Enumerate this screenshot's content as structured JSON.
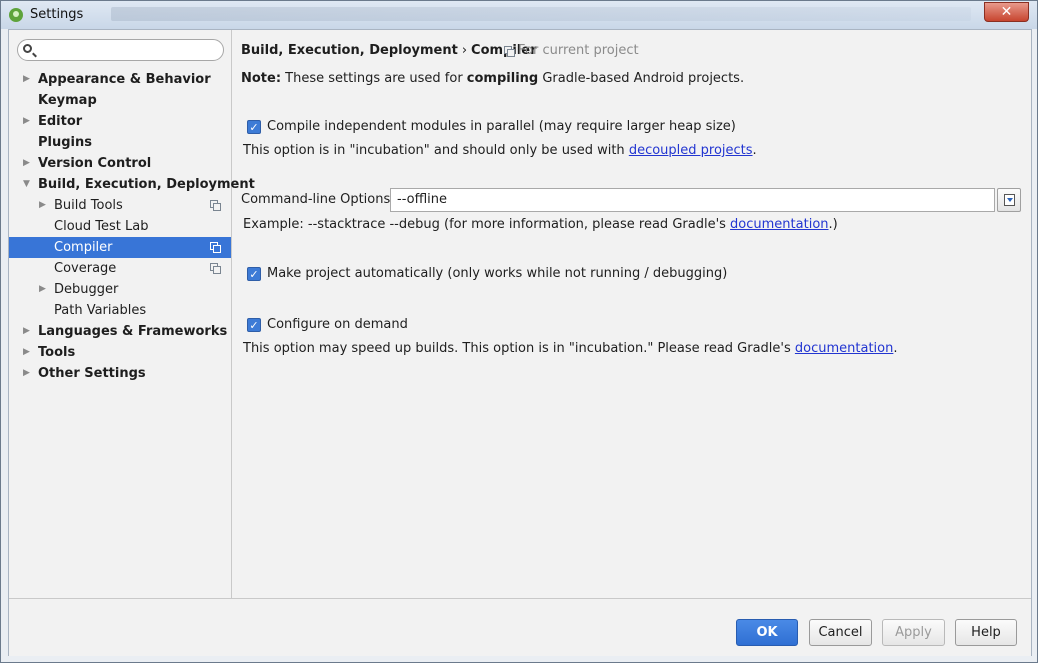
{
  "window": {
    "title": "Settings",
    "close_label": "✕"
  },
  "sidebar": {
    "search": {
      "value": "",
      "placeholder": ""
    },
    "items": [
      {
        "label": "Appearance & Behavior",
        "expandable": true,
        "bold": true
      },
      {
        "label": "Keymap",
        "expandable": false,
        "bold": true
      },
      {
        "label": "Editor",
        "expandable": true,
        "bold": true
      },
      {
        "label": "Plugins",
        "expandable": false,
        "bold": true
      },
      {
        "label": "Version Control",
        "expandable": true,
        "bold": true
      },
      {
        "label": "Build, Execution, Deployment",
        "expandable": true,
        "expanded": true,
        "bold": true
      },
      {
        "label": "Build Tools",
        "expandable": true,
        "child": true,
        "project_scoped": true
      },
      {
        "label": "Cloud Test Lab",
        "child": true
      },
      {
        "label": "Compiler",
        "child": true,
        "selected": true,
        "project_scoped": true
      },
      {
        "label": "Coverage",
        "child": true,
        "project_scoped": true
      },
      {
        "label": "Debugger",
        "expandable": true,
        "child": true
      },
      {
        "label": "Path Variables",
        "child": true
      },
      {
        "label": "Languages & Frameworks",
        "expandable": true,
        "bold": true
      },
      {
        "label": "Tools",
        "expandable": true,
        "bold": true
      },
      {
        "label": "Other Settings",
        "expandable": true,
        "bold": true
      }
    ]
  },
  "header": {
    "parent": "Build, Execution, Deployment",
    "separator": "›",
    "current": "Compiler",
    "scope": "For current project"
  },
  "note": {
    "label": "Note:",
    "text_before": " These settings are used for ",
    "bold_word": "compiling",
    "text_after": " Gradle-based Android projects."
  },
  "options": {
    "parallel": {
      "checked": true,
      "label": "Compile independent modules in parallel (may require larger heap size)",
      "hint_before": "This option is in \"incubation\" and should only be used with ",
      "hint_link": "decoupled projects",
      "hint_after": "."
    },
    "cmdline": {
      "label": "Command-line Options:",
      "value": "--offline",
      "example_before": "Example: --stacktrace --debug (for more information, please read Gradle's ",
      "example_link": "documentation",
      "example_after": ".)"
    },
    "make_auto": {
      "checked": true,
      "label": "Make project automatically (only works while not running / debugging)"
    },
    "configure_demand": {
      "checked": true,
      "label": "Configure on demand",
      "hint_before": "This option may speed up builds. This option is in \"incubation.\" Please read Gradle's ",
      "hint_link": "documentation",
      "hint_after": "."
    }
  },
  "footer": {
    "ok": "OK",
    "cancel": "Cancel",
    "apply": "Apply",
    "help": "Help"
  },
  "colors": {
    "selection": "#3875d7",
    "link": "#2235d1",
    "primary_button": "#2f6fd3"
  }
}
